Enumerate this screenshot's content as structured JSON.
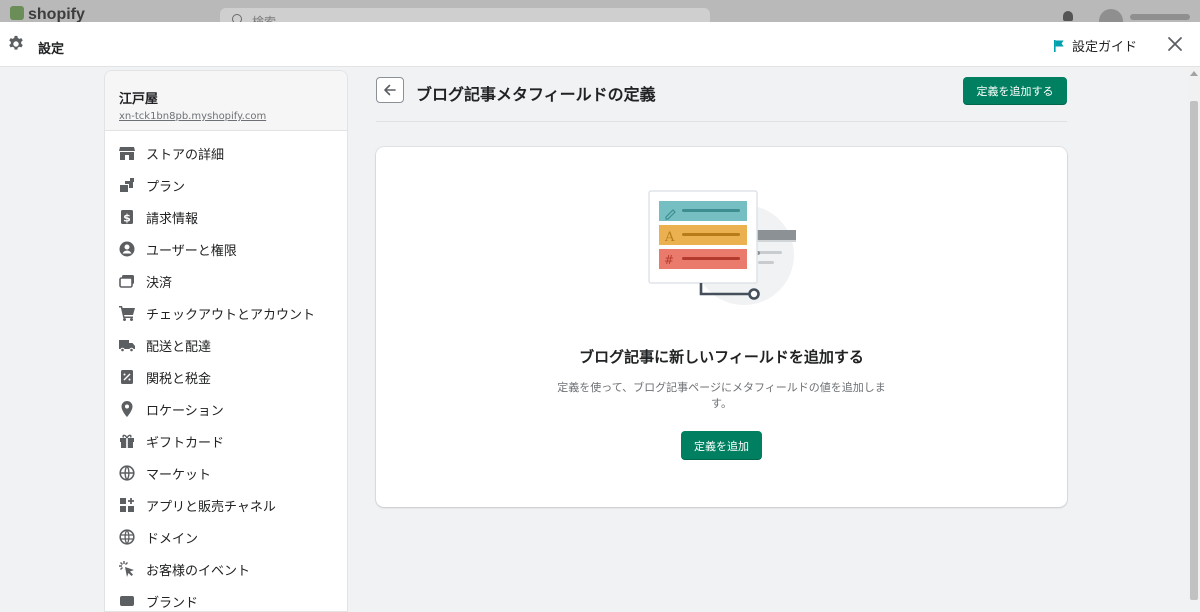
{
  "app": {
    "logo_text": "shopify",
    "search_placeholder": "検索"
  },
  "header": {
    "title": "設定",
    "guide_label": "設定ガイド"
  },
  "store": {
    "name": "江戸屋",
    "domain": "xn-tck1bn8pb.myshopify.com"
  },
  "sidebar": {
    "items": [
      {
        "label": "ストアの詳細",
        "icon": "store-icon"
      },
      {
        "label": "プラン",
        "icon": "plan-icon"
      },
      {
        "label": "請求情報",
        "icon": "billing-icon"
      },
      {
        "label": "ユーザーと権限",
        "icon": "user-icon"
      },
      {
        "label": "決済",
        "icon": "payment-icon"
      },
      {
        "label": "チェックアウトとアカウント",
        "icon": "cart-icon"
      },
      {
        "label": "配送と配達",
        "icon": "truck-icon"
      },
      {
        "label": "関税と税金",
        "icon": "tax-icon"
      },
      {
        "label": "ロケーション",
        "icon": "location-icon"
      },
      {
        "label": "ギフトカード",
        "icon": "gift-icon"
      },
      {
        "label": "マーケット",
        "icon": "globe-icon"
      },
      {
        "label": "アプリと販売チャネル",
        "icon": "apps-icon"
      },
      {
        "label": "ドメイン",
        "icon": "domain-icon"
      },
      {
        "label": "お客様のイベント",
        "icon": "cursor-icon"
      },
      {
        "label": "ブランド",
        "icon": "brand-icon"
      }
    ]
  },
  "main": {
    "title": "ブログ記事メタフィールドの定義",
    "add_definition_button": "定義を追加する",
    "empty_state": {
      "heading": "ブログ記事に新しいフィールドを追加する",
      "description": "定義を使って、ブログ記事ページにメタフィールドの値を追加します。",
      "button": "定義を追加"
    }
  },
  "colors": {
    "primary": "#008060",
    "background": "#f1f2f4",
    "guide_flag": "#00a0ac"
  }
}
